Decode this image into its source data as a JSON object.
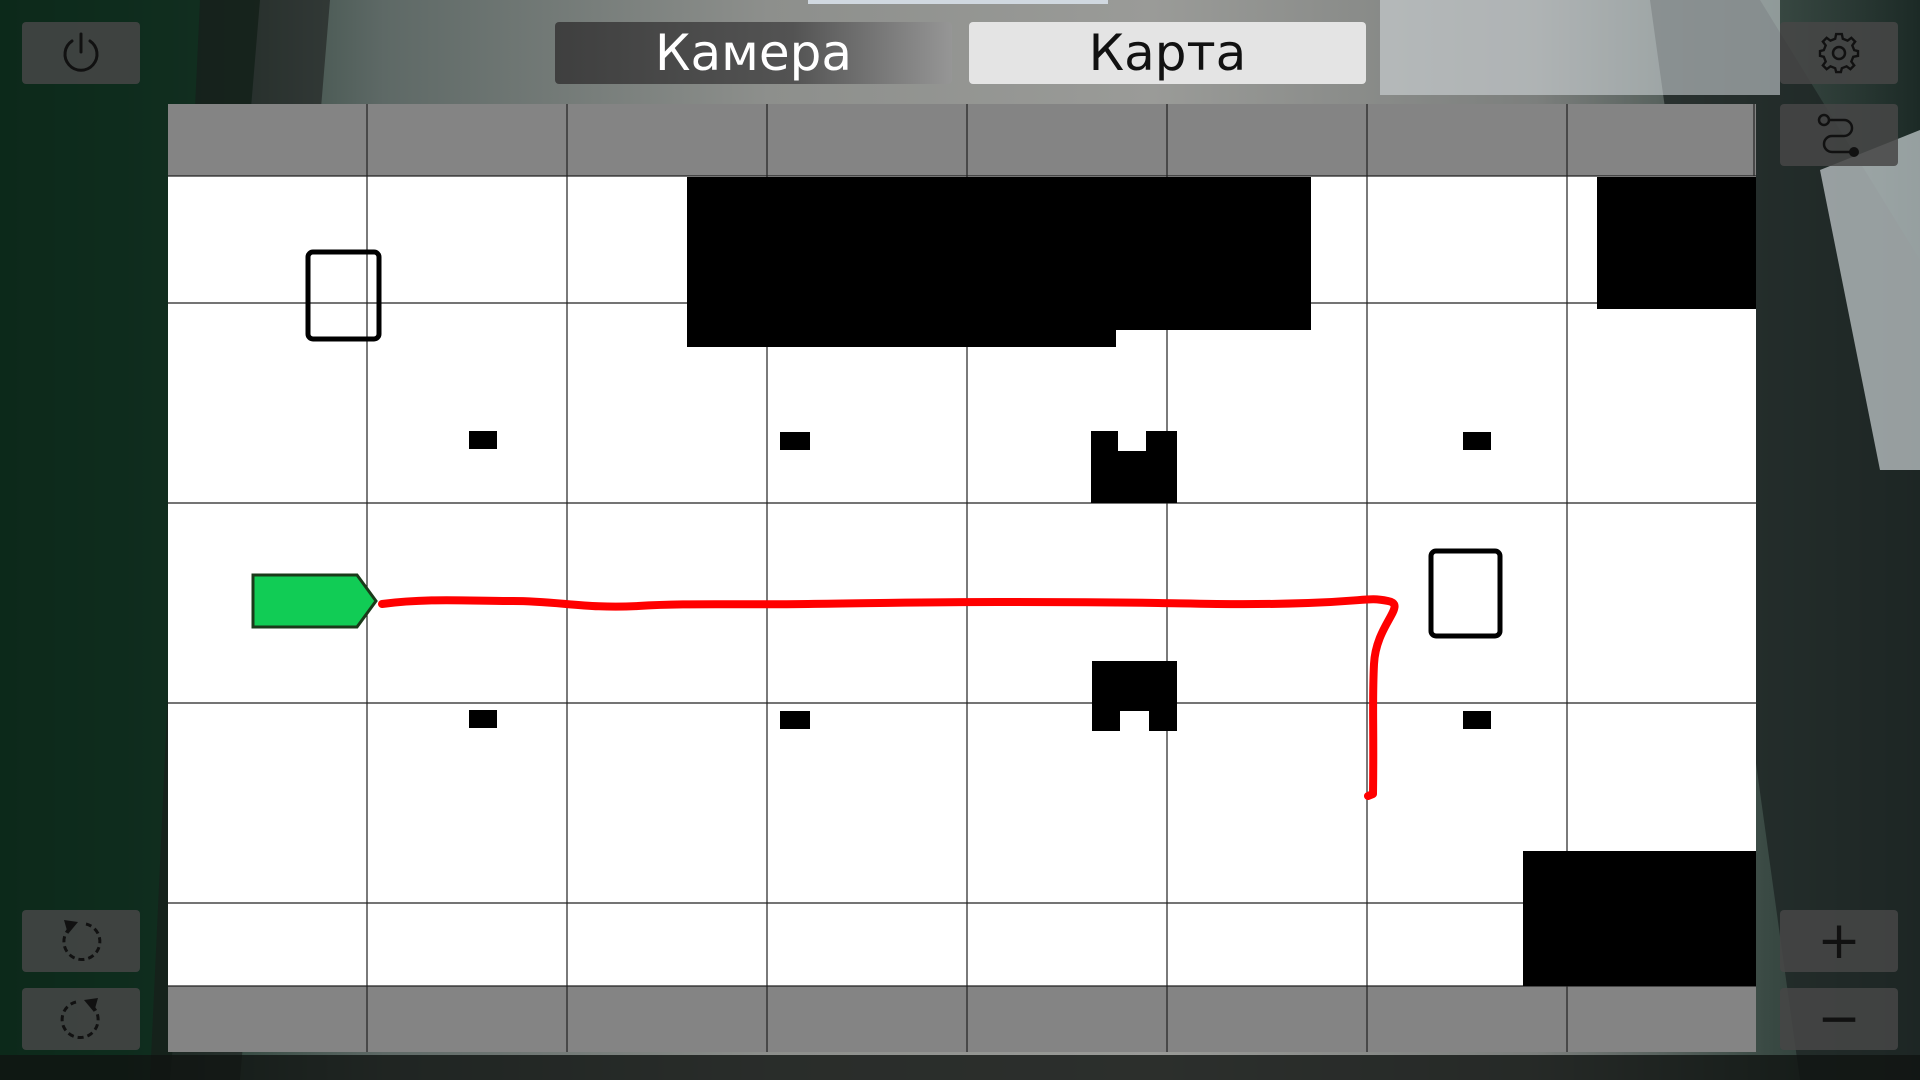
{
  "tabs": [
    {
      "id": "camera",
      "label": "Камера",
      "active": false
    },
    {
      "id": "map",
      "label": "Карта",
      "active": true
    }
  ],
  "left_buttons": [
    {
      "id": "power",
      "icon": "power-icon"
    },
    {
      "id": "rotate-left",
      "icon": "rotate-ccw-icon"
    },
    {
      "id": "rotate-right",
      "icon": "rotate-cw-icon"
    }
  ],
  "right_buttons": [
    {
      "id": "settings",
      "icon": "gear-icon"
    },
    {
      "id": "route",
      "icon": "route-icon"
    },
    {
      "id": "zoom-in",
      "icon": "plus-icon",
      "label": "+"
    },
    {
      "id": "zoom-out",
      "icon": "minus-icon",
      "label": "−"
    }
  ],
  "map": {
    "grid_columns": 8,
    "grid_rows": 6,
    "robot_color": "#11cc55",
    "path_color": "#ff0000",
    "obstacle_color": "#000000",
    "header_strip_color": "#848484"
  }
}
